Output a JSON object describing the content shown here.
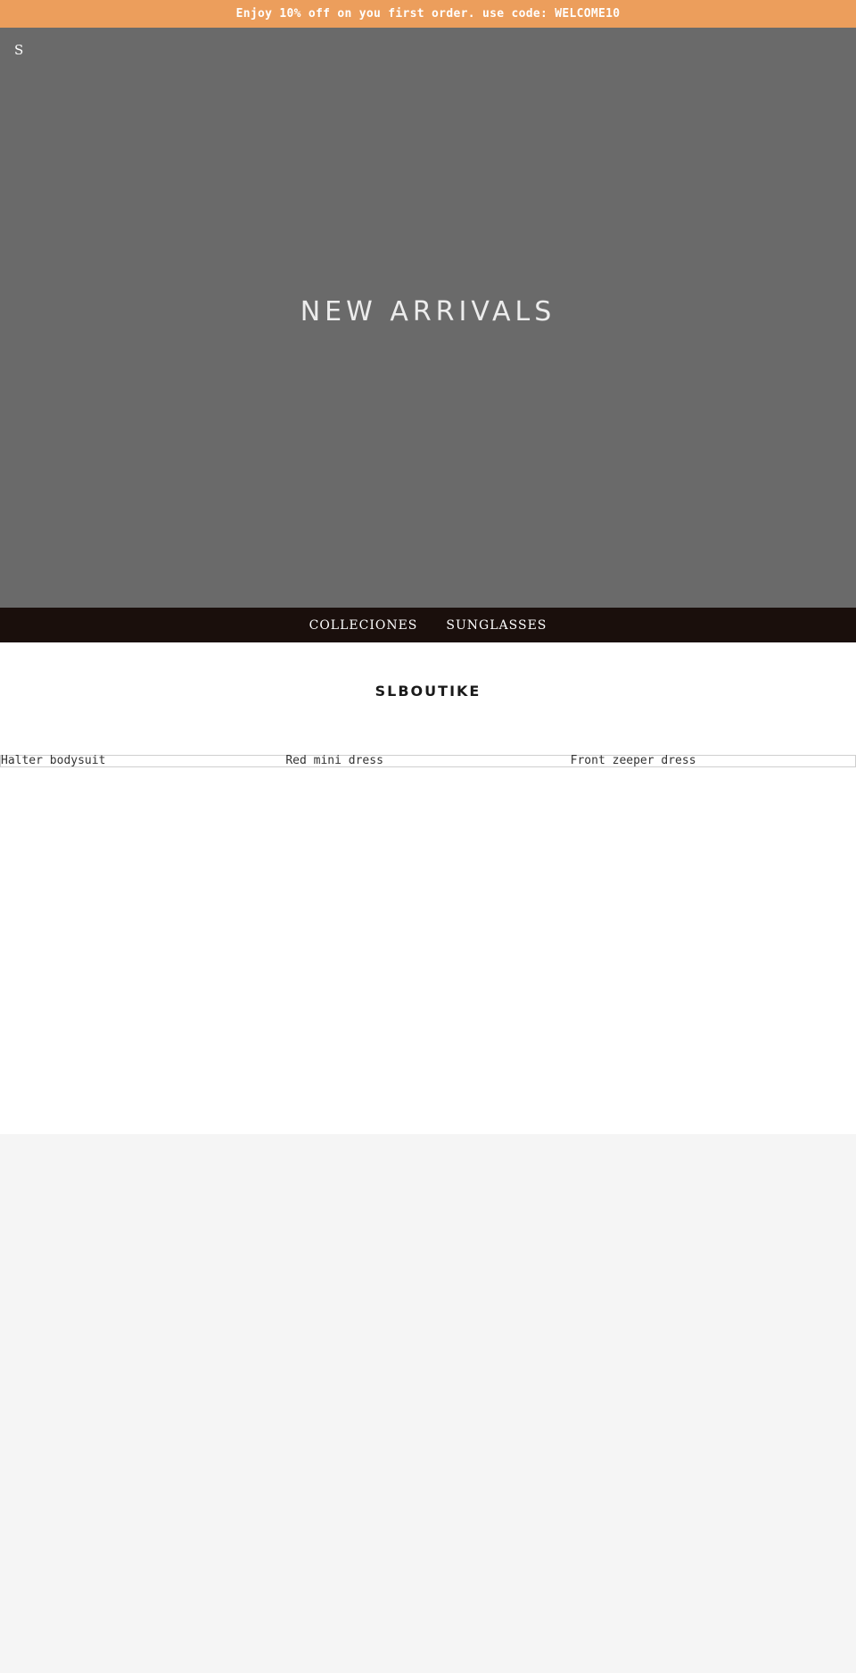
{
  "announcement": {
    "text": "Enjoy 10% off on you first order. use code: WELCOME10"
  },
  "header": {
    "brand_mark": "S"
  },
  "hero": {
    "title": "NEW ARRIVALS"
  },
  "nav": {
    "items": [
      {
        "label": "COLLECIONES"
      },
      {
        "label": "SUNGLASSES"
      }
    ]
  },
  "store": {
    "title": "SLBOUTIKE"
  },
  "products": [
    {
      "title": "Halter bodysuit"
    },
    {
      "title": "Red mini dress"
    },
    {
      "title": "Front zeeper dress"
    }
  ],
  "colors": {
    "announcement_bg": "#ec9e5c",
    "hero_bg": "#6a6a6a",
    "nav_bg": "#1a0f0c",
    "footer_bg": "#f5f5f5"
  }
}
